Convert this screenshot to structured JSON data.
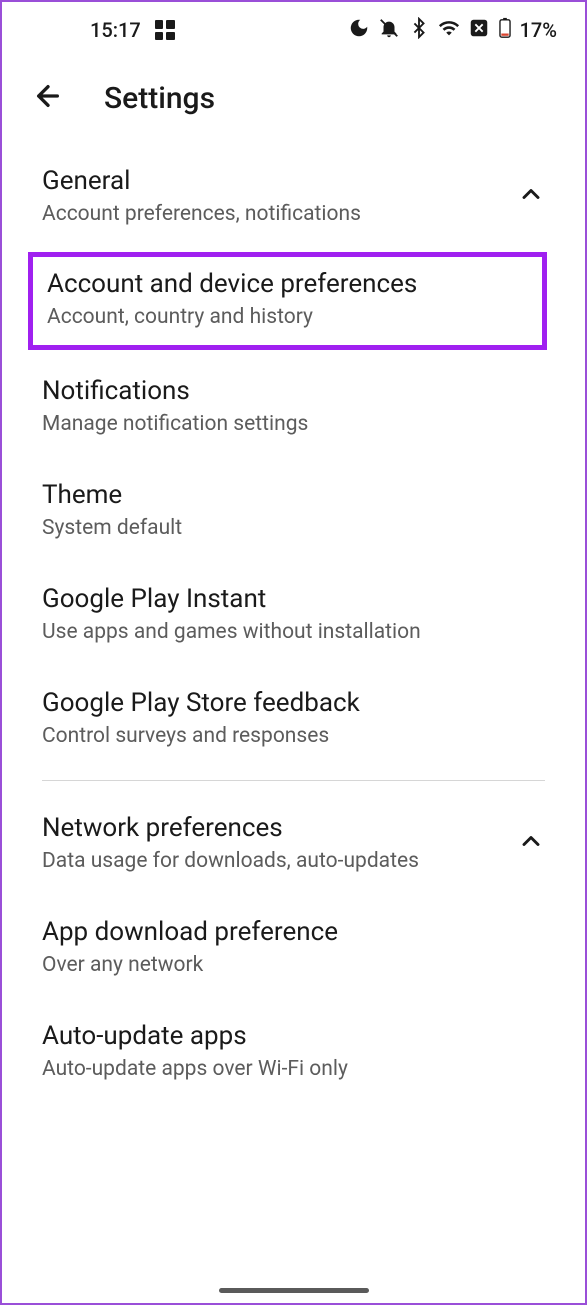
{
  "statusBar": {
    "time": "15:17",
    "battery": "17%"
  },
  "header": {
    "title": "Settings"
  },
  "sections": {
    "general": {
      "title": "General",
      "subtitle": "Account preferences, notifications"
    },
    "accountDevice": {
      "title": "Account and device preferences",
      "subtitle": "Account, country and history"
    },
    "notifications": {
      "title": "Notifications",
      "subtitle": "Manage notification settings"
    },
    "theme": {
      "title": "Theme",
      "subtitle": "System default"
    },
    "instant": {
      "title": "Google Play Instant",
      "subtitle": "Use apps and games without installation"
    },
    "feedback": {
      "title": "Google Play Store feedback",
      "subtitle": "Control surveys and responses"
    },
    "network": {
      "title": "Network preferences",
      "subtitle": "Data usage for downloads, auto-updates"
    },
    "download": {
      "title": "App download preference",
      "subtitle": "Over any network"
    },
    "autoUpdate": {
      "title": "Auto-update apps",
      "subtitle": "Auto-update apps over Wi-Fi only"
    }
  }
}
